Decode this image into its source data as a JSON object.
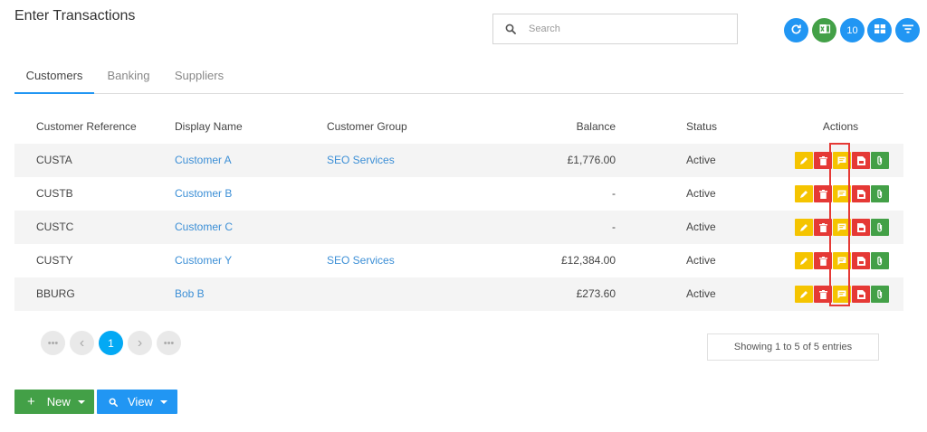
{
  "page": {
    "title": "Enter Transactions"
  },
  "search": {
    "placeholder": "Search",
    "value": ""
  },
  "toolbar": {
    "refresh_icon": "refresh-icon",
    "excel_icon": "excel-icon",
    "page_size": "10",
    "grid_icon": "grid-icon",
    "filter_icon": "filter-icon",
    "colors": {
      "blue": "#2196f3",
      "green": "#43a047"
    }
  },
  "tabs": [
    {
      "label": "Customers",
      "active": true
    },
    {
      "label": "Banking",
      "active": false
    },
    {
      "label": "Suppliers",
      "active": false
    }
  ],
  "table": {
    "headers": {
      "ref": "Customer Reference",
      "name": "Display Name",
      "group": "Customer Group",
      "balance": "Balance",
      "status": "Status",
      "actions": "Actions"
    },
    "rows": [
      {
        "ref": "CUSTA",
        "name": "Customer A",
        "group": "SEO Services",
        "balance": "£1,776.00",
        "status": "Active"
      },
      {
        "ref": "CUSTB",
        "name": "Customer B",
        "group": "",
        "balance": "-",
        "status": "Active"
      },
      {
        "ref": "CUSTC",
        "name": "Customer C",
        "group": "",
        "balance": "-",
        "status": "Active"
      },
      {
        "ref": "CUSTY",
        "name": "Customer Y",
        "group": "SEO Services",
        "balance": "£12,384.00",
        "status": "Active"
      },
      {
        "ref": "BBURG",
        "name": "Bob B",
        "group": "",
        "balance": "£273.60",
        "status": "Active"
      }
    ],
    "action_icons": [
      "edit-icon",
      "delete-icon",
      "comment-icon",
      "pdf-icon",
      "attachment-icon"
    ],
    "action_colors": {
      "edit": "#f5c400",
      "delete": "#e53935",
      "comment": "#f5c400",
      "pdf": "#e53935",
      "attachment": "#43a047"
    }
  },
  "pagination": {
    "first": "•••",
    "prev": "‹",
    "current": "1",
    "next": "›",
    "last": "•••",
    "summary": "Showing 1 to 5 of 5 entries"
  },
  "buttons": {
    "new_label": "New",
    "view_label": "View"
  }
}
